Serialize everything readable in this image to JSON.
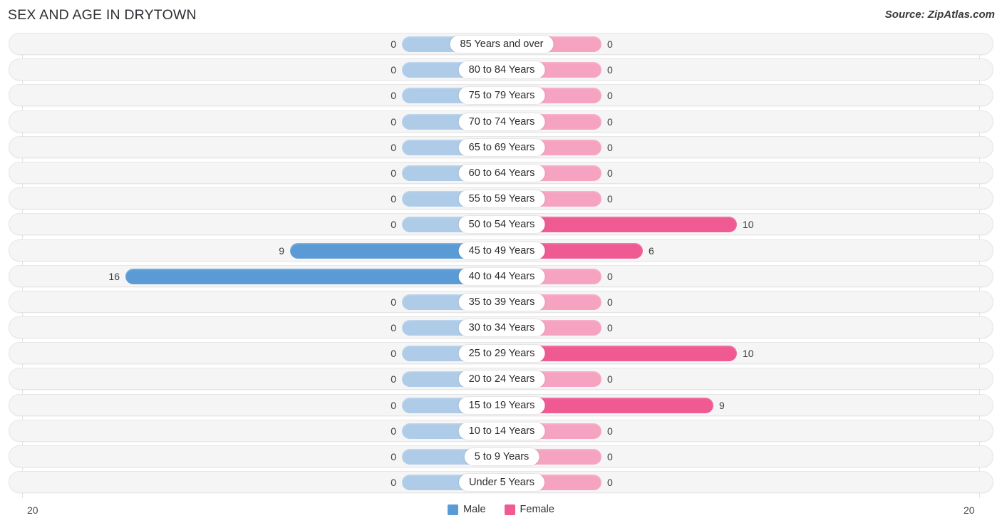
{
  "header": {
    "title": "SEX AND AGE IN DRYTOWN",
    "source": "Source: ZipAtlas.com"
  },
  "footer": {
    "axis_min_label": "20",
    "axis_max_label": "20",
    "legend": [
      {
        "label": "Male",
        "color": "#5b9bd5",
        "icon": "male-swatch"
      },
      {
        "label": "Female",
        "color": "#ef5a93",
        "icon": "female-swatch"
      }
    ]
  },
  "chart_data": {
    "type": "bar",
    "subtype": "population-pyramid",
    "title": "SEX AND AGE IN DRYTOWN",
    "xlabel": "",
    "ylabel": "",
    "orientation": "horizontal",
    "axis_max": 20,
    "axis_left_tick": "20",
    "axis_right_tick": "20",
    "grid": true,
    "legend_position": "bottom-center",
    "categories": [
      "85 Years and over",
      "80 to 84 Years",
      "75 to 79 Years",
      "70 to 74 Years",
      "65 to 69 Years",
      "60 to 64 Years",
      "55 to 59 Years",
      "50 to 54 Years",
      "45 to 49 Years",
      "40 to 44 Years",
      "35 to 39 Years",
      "30 to 34 Years",
      "25 to 29 Years",
      "20 to 24 Years",
      "15 to 19 Years",
      "10 to 14 Years",
      "5 to 9 Years",
      "Under 5 Years"
    ],
    "series": [
      {
        "name": "Male",
        "color": "#5b9bd5",
        "values": [
          0,
          0,
          0,
          0,
          0,
          0,
          0,
          0,
          9,
          16,
          0,
          0,
          0,
          0,
          0,
          0,
          0,
          0
        ]
      },
      {
        "name": "Female",
        "color": "#ef5a93",
        "values": [
          0,
          0,
          0,
          0,
          0,
          0,
          0,
          10,
          6,
          0,
          0,
          0,
          0,
          0,
          9,
          0,
          0,
          0
        ]
      }
    ],
    "rows": [
      {
        "age": "85 Years and over",
        "male": 0,
        "female": 0,
        "male_label": "0",
        "female_label": "0"
      },
      {
        "age": "80 to 84 Years",
        "male": 0,
        "female": 0,
        "male_label": "0",
        "female_label": "0"
      },
      {
        "age": "75 to 79 Years",
        "male": 0,
        "female": 0,
        "male_label": "0",
        "female_label": "0"
      },
      {
        "age": "70 to 74 Years",
        "male": 0,
        "female": 0,
        "male_label": "0",
        "female_label": "0"
      },
      {
        "age": "65 to 69 Years",
        "male": 0,
        "female": 0,
        "male_label": "0",
        "female_label": "0"
      },
      {
        "age": "60 to 64 Years",
        "male": 0,
        "female": 0,
        "male_label": "0",
        "female_label": "0"
      },
      {
        "age": "55 to 59 Years",
        "male": 0,
        "female": 0,
        "male_label": "0",
        "female_label": "0"
      },
      {
        "age": "50 to 54 Years",
        "male": 0,
        "female": 10,
        "male_label": "0",
        "female_label": "10"
      },
      {
        "age": "45 to 49 Years",
        "male": 9,
        "female": 6,
        "male_label": "9",
        "female_label": "6"
      },
      {
        "age": "40 to 44 Years",
        "male": 16,
        "female": 0,
        "male_label": "16",
        "female_label": "0"
      },
      {
        "age": "35 to 39 Years",
        "male": 0,
        "female": 0,
        "male_label": "0",
        "female_label": "0"
      },
      {
        "age": "30 to 34 Years",
        "male": 0,
        "female": 0,
        "male_label": "0",
        "female_label": "0"
      },
      {
        "age": "25 to 29 Years",
        "male": 0,
        "female": 10,
        "male_label": "0",
        "female_label": "10"
      },
      {
        "age": "20 to 24 Years",
        "male": 0,
        "female": 0,
        "male_label": "0",
        "female_label": "0"
      },
      {
        "age": "15 to 19 Years",
        "male": 0,
        "female": 9,
        "male_label": "0",
        "female_label": "9"
      },
      {
        "age": "10 to 14 Years",
        "male": 0,
        "female": 0,
        "male_label": "0",
        "female_label": "0"
      },
      {
        "age": "5 to 9 Years",
        "male": 0,
        "female": 0,
        "male_label": "0",
        "female_label": "0"
      },
      {
        "age": "Under 5 Years",
        "male": 0,
        "female": 0,
        "male_label": "0",
        "female_label": "0"
      }
    ]
  }
}
